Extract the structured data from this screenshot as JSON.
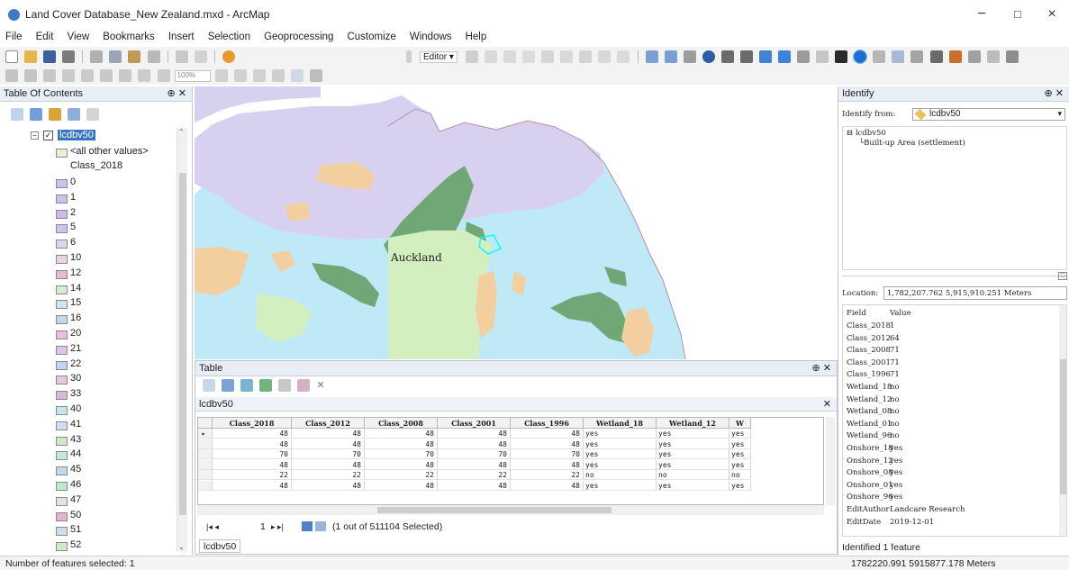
{
  "window": {
    "title": "Land Cover Database_New Zealand.mxd - ArcMap",
    "minimize": "−",
    "maximize": "□",
    "close": "×"
  },
  "menu": {
    "file": "File",
    "edit": "Edit",
    "view": "View",
    "bookmarks": "Bookmarks",
    "insert": "Insert",
    "selection": "Selection",
    "geoprocessing": "Geoprocessing",
    "customize": "Customize",
    "windows": "Windows",
    "help": "Help"
  },
  "toolbar": {
    "editor_label": "Editor ▾",
    "zoom_value": "100%"
  },
  "toc": {
    "title": "Table Of Contents",
    "layer_name": "lcdbv50",
    "all_other_values": "<all other values>",
    "field_heading": "Class_2018",
    "classes": [
      {
        "label": "0",
        "color": "#c9c3ee"
      },
      {
        "label": "1",
        "color": "#cdbfee"
      },
      {
        "label": "2",
        "color": "#d3b6ea"
      },
      {
        "label": "5",
        "color": "#c9c6ee"
      },
      {
        "label": "6",
        "color": "#dcd8f2"
      },
      {
        "label": "10",
        "color": "#ecd2e6"
      },
      {
        "label": "12",
        "color": "#e6b9cf"
      },
      {
        "label": "14",
        "color": "#d6ecd1"
      },
      {
        "label": "15",
        "color": "#cde6ee"
      },
      {
        "label": "16",
        "color": "#c6d4ee"
      },
      {
        "label": "20",
        "color": "#e9bed8"
      },
      {
        "label": "21",
        "color": "#ddc3e4"
      },
      {
        "label": "22",
        "color": "#c1d6ee"
      },
      {
        "label": "30",
        "color": "#e6c7de"
      },
      {
        "label": "33",
        "color": "#d9b9da"
      },
      {
        "label": "40",
        "color": "#c6e6ee"
      },
      {
        "label": "41",
        "color": "#d1dcef"
      },
      {
        "label": "43",
        "color": "#cde9c8"
      },
      {
        "label": "44",
        "color": "#c3e8d4"
      },
      {
        "label": "45",
        "color": "#bfd9f0"
      },
      {
        "label": "46",
        "color": "#bfeac9"
      },
      {
        "label": "47",
        "color": "#e5e0ec"
      },
      {
        "label": "50",
        "color": "#e2b3cc"
      },
      {
        "label": "51",
        "color": "#cde0ea"
      },
      {
        "label": "52",
        "color": "#d2e8c6"
      }
    ]
  },
  "map": {
    "place_label": "Auckland"
  },
  "table": {
    "title": "Table",
    "tab_name": "lcdbv50",
    "columns": [
      "Class_2018",
      "Class_2012",
      "Class_2008",
      "Class_2001",
      "Class_1996",
      "Wetland_18",
      "Wetland_12",
      "W"
    ],
    "rows": [
      [
        "48",
        "48",
        "48",
        "48",
        "48",
        "yes",
        "yes",
        "yes"
      ],
      [
        "48",
        "48",
        "48",
        "48",
        "48",
        "yes",
        "yes",
        "yes"
      ],
      [
        "70",
        "70",
        "70",
        "70",
        "70",
        "yes",
        "yes",
        "yes"
      ],
      [
        "48",
        "48",
        "48",
        "48",
        "48",
        "yes",
        "yes",
        "yes"
      ],
      [
        "22",
        "22",
        "22",
        "22",
        "22",
        "no",
        "no",
        "no"
      ],
      [
        "48",
        "48",
        "48",
        "48",
        "48",
        "yes",
        "yes",
        "yes"
      ]
    ],
    "record_number": "1",
    "selection_text": "(1 out of 511104 Selected)",
    "bottom_tab": "lcdbv50"
  },
  "identify": {
    "title": "Identify",
    "from_label": "Identify from:",
    "from_value": "lcdbv50",
    "tree_layer": "lcdbv50",
    "tree_feature": "Built-up Area (settlement)",
    "location_label": "Location:",
    "location_value": "1,782,207.762  5,915,910.251 Meters",
    "field_header": "Field",
    "value_header": "Value",
    "attributes": [
      {
        "field": "Class_2018",
        "value": "1"
      },
      {
        "field": "Class_2012",
        "value": "64"
      },
      {
        "field": "Class_2008",
        "value": "71"
      },
      {
        "field": "Class_2001",
        "value": "71"
      },
      {
        "field": "Class_1996",
        "value": "71"
      },
      {
        "field": "Wetland_18",
        "value": "no"
      },
      {
        "field": "Wetland_12",
        "value": "no"
      },
      {
        "field": "Wetland_08",
        "value": "no"
      },
      {
        "field": "Wetland_01",
        "value": "no"
      },
      {
        "field": "Wetland_96",
        "value": "no"
      },
      {
        "field": "Onshore_18",
        "value": "yes"
      },
      {
        "field": "Onshore_12",
        "value": "yes"
      },
      {
        "field": "Onshore_08",
        "value": "yes"
      },
      {
        "field": "Onshore_01",
        "value": "yes"
      },
      {
        "field": "Onshore_96",
        "value": "yes"
      },
      {
        "field": "EditAuthor",
        "value": "Landcare Research"
      },
      {
        "field": "EditDate",
        "value": "2019-12-01"
      }
    ],
    "status": "Identified 1 feature"
  },
  "status": {
    "left": "Number of features selected: 1",
    "right": "1782220.991  5915877.178 Meters"
  },
  "colors": {
    "water": "#bfe9f7",
    "lavender": "#d7d1ef",
    "forest": "#6fa777",
    "pasture": "#d4efbf",
    "sand": "#f3cf9f",
    "selection": "#00ffff"
  }
}
